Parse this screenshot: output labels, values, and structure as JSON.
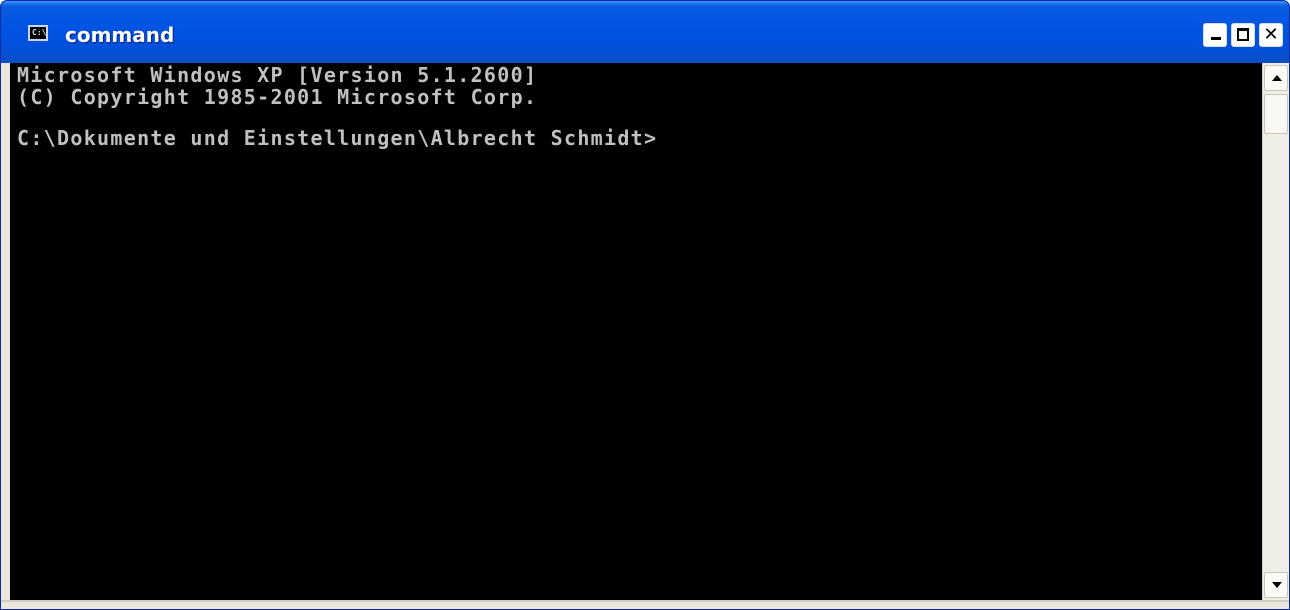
{
  "window": {
    "title": "command",
    "icon_name": "console-icon",
    "icon_glyph": "C:\\",
    "controls": {
      "minimize_icon": "minimize-icon",
      "maximize_icon": "maximize-icon",
      "close_icon": "close-icon",
      "close_glyph": "✕"
    },
    "colors": {
      "titlebar": "#0054e3",
      "console_background": "#000000",
      "console_text": "#c0c0c0"
    }
  },
  "console": {
    "lines": [
      "Microsoft Windows XP [Version 5.1.2600]",
      "(C) Copyright 1985-2001 Microsoft Corp.",
      "C:\\Dokumente und Einstellungen\\Albrecht Schmidt>"
    ]
  },
  "scrollbar": {
    "up_icon": "scroll-up-arrow-icon",
    "down_icon": "scroll-down-arrow-icon"
  }
}
